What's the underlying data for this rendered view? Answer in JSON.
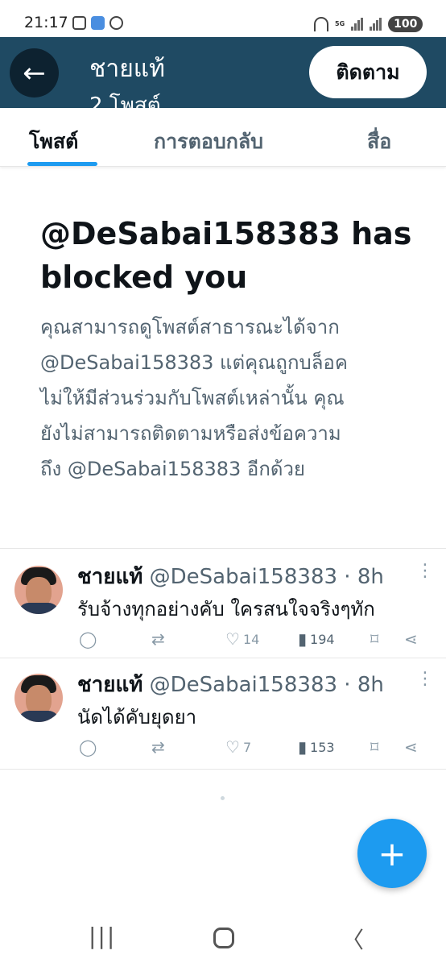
{
  "status_bar": {
    "time": "21:17",
    "network": "5G",
    "battery": "100",
    "icons_left": [
      "screenshot-icon",
      "gallery-icon",
      "chat-icon"
    ],
    "icons_right": [
      "wifi-calling-icon",
      "signal-icon",
      "signal-icon"
    ]
  },
  "header": {
    "name": "ชายแท้",
    "subtitle": "2 โพสต์",
    "follow_label": "ติดตาม",
    "colors": {
      "background": "#1f4a63",
      "back_button": "#0d2230"
    }
  },
  "tabs": [
    {
      "label": "โพสต์",
      "active": true
    },
    {
      "label": "การตอบกลับ",
      "active": false
    },
    {
      "label": "สื่อ",
      "active": false
    }
  ],
  "blocked": {
    "title": "@DeSabai158383 has blocked you",
    "lines": [
      "คุณสามารถดูโพสต์สาธารณะได้จาก",
      "@DeSabai158383 แต่คุณถูกบล็อค",
      "ไม่ให้มีส่วนร่วมกับโพสต์เหล่านั้น คุณ",
      "ยังไม่สามารถติดตามหรือส่งข้อความ",
      "ถึง @DeSabai158383 อีกด้วย"
    ]
  },
  "posts": [
    {
      "name": "ชายแท้",
      "handle": "@DeSabai158383 · 8h",
      "text": "รับจ้างทุกอย่างคับ ใครสนใจจริงๆทัก",
      "likes": "14",
      "views": "194"
    },
    {
      "name": "ชายแท้",
      "handle": "@DeSabai158383 · 8h",
      "text": "นัดได้คับยุดยา",
      "likes": "7",
      "views": "153"
    }
  ],
  "fab_label": "+",
  "accent_color": "#1d9bf0"
}
